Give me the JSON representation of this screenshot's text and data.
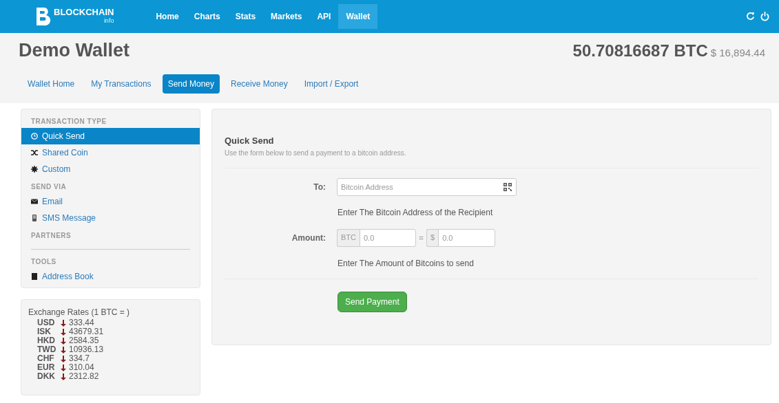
{
  "navbar": {
    "logo": "BLOCKCHAIN",
    "logo_sub": "info",
    "links": [
      {
        "label": "Home",
        "selected": false
      },
      {
        "label": "Charts",
        "selected": false
      },
      {
        "label": "Stats",
        "selected": false
      },
      {
        "label": "Markets",
        "selected": false
      },
      {
        "label": "API",
        "selected": false
      },
      {
        "label": "Wallet",
        "selected": true
      }
    ]
  },
  "header": {
    "title": "Demo Wallet",
    "balance": "50.70816687 BTC",
    "balance_usd": "$ 16,894.44"
  },
  "tabs": [
    {
      "label": "Wallet Home",
      "selected": false
    },
    {
      "label": "My Transactions",
      "selected": false
    },
    {
      "label": "Send Money",
      "selected": true
    },
    {
      "label": "Receive Money",
      "selected": false
    },
    {
      "label": "Import / Export",
      "selected": false
    }
  ],
  "sidebar": {
    "sections": [
      {
        "heading": "TRANSACTION TYPE",
        "items": [
          {
            "label": "Quick Send",
            "kind": "clock",
            "selected": true
          },
          {
            "label": "Shared Coin",
            "kind": "shuffle",
            "selected": false
          },
          {
            "label": "Custom",
            "kind": "gear",
            "selected": false
          }
        ]
      },
      {
        "heading": "SEND VIA",
        "items": [
          {
            "label": "Email",
            "kind": "envelope",
            "selected": false
          },
          {
            "label": "SMS Message",
            "kind": "phone",
            "selected": false
          }
        ]
      },
      {
        "heading": "PARTNERS",
        "divider": true
      },
      {
        "heading": "TOOLS",
        "items": [
          {
            "label": "Address Book",
            "kind": "book",
            "selected": false
          }
        ]
      }
    ]
  },
  "rates": {
    "title": "Exchange Rates (1 BTC = )",
    "rows": [
      {
        "currency": "USD",
        "kind": "down",
        "value": "333.44"
      },
      {
        "currency": "ISK",
        "kind": "down",
        "value": "43679.31"
      },
      {
        "currency": "HKD",
        "kind": "down",
        "value": "2584.35"
      },
      {
        "currency": "TWD",
        "kind": "down",
        "value": "10936.13"
      },
      {
        "currency": "CHF",
        "kind": "down",
        "value": "334.7"
      },
      {
        "currency": "EUR",
        "kind": "down",
        "value": "310.04"
      },
      {
        "currency": "DKK",
        "kind": "down",
        "value": "2312.82"
      }
    ]
  },
  "form": {
    "title": "Quick Send",
    "subtitle": "Use the form below to send a payment to a bitcoin address.",
    "to_label": "To:",
    "to_placeholder": "Bitcoin Address",
    "to_help": "Enter The Bitcoin Address of the Recipient",
    "amount_label": "Amount:",
    "btc_addon": "BTC",
    "btc_placeholder": "0.0",
    "equals": "=",
    "usd_addon": "$",
    "usd_placeholder": "0.0",
    "amount_help": "Enter The Amount of Bitcoins to send",
    "submit": "Send Payment"
  }
}
